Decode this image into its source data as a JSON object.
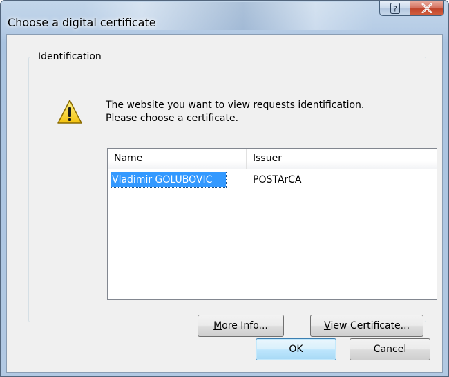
{
  "window": {
    "title": "Choose a digital certificate",
    "help_glyph": "?",
    "close_glyph": "X"
  },
  "group": {
    "label": "Identification"
  },
  "message": {
    "line1": "The website you want to view requests identification.",
    "line2": "Please choose a certificate.",
    "icon": "warning-icon"
  },
  "list": {
    "columns": [
      "Name",
      "Issuer"
    ],
    "rows": [
      {
        "name": "Vladimir GOLUBOVIC",
        "issuer": "POSTArCA",
        "selected": true
      }
    ]
  },
  "buttons": {
    "more_info": {
      "mnemonic": "M",
      "rest": "ore Info..."
    },
    "view_certificate": {
      "mnemonic": "V",
      "rest": "iew Certificate..."
    },
    "ok": "OK",
    "cancel": "Cancel"
  },
  "colors": {
    "selection": "#3399ff",
    "client_background": "#f0f0f0",
    "close_button": "#c0442b"
  }
}
